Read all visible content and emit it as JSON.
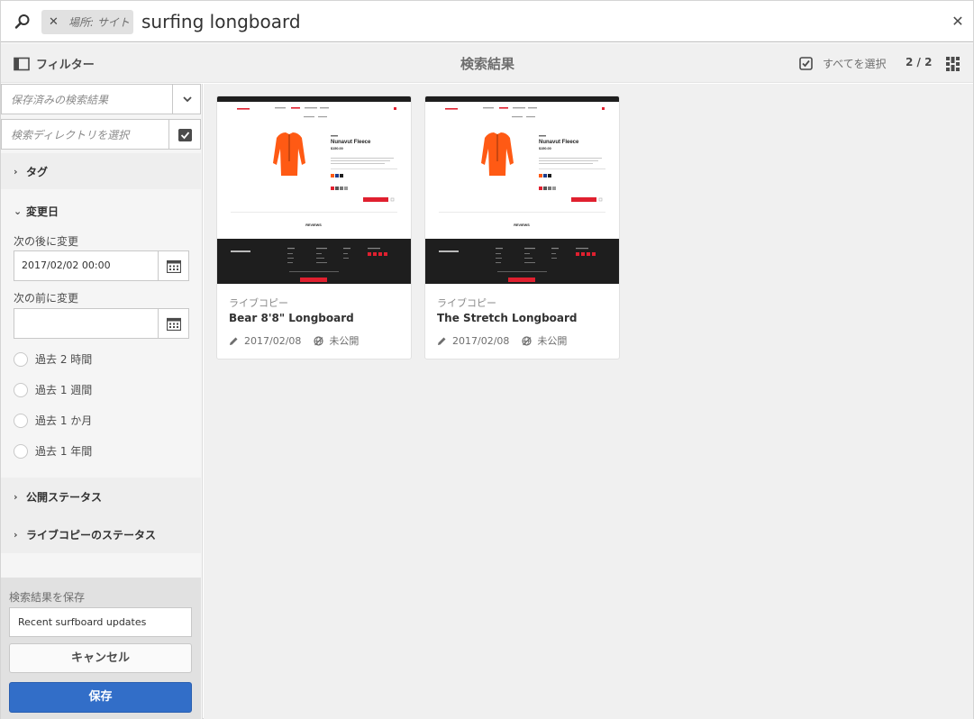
{
  "search": {
    "scope_tag": "場所: サイト",
    "query": "surfing longboard"
  },
  "actionbar": {
    "filter_label": "フィルター",
    "title": "検索結果",
    "select_all_label": "すべてを選択",
    "count": "2 / 2"
  },
  "rail": {
    "saved_search_placeholder": "保存済みの検索結果",
    "directory_placeholder": "検索ディレクトリを選択",
    "tag_section": "タグ",
    "modified_section": "変更日",
    "modified_after_label": "次の後に変更",
    "modified_after_value": "2017/02/02 00:00",
    "modified_before_label": "次の前に変更",
    "modified_before_value": "",
    "radios": [
      "過去 2 時間",
      "過去 1 週間",
      "過去 1 か月",
      "過去 1 年間"
    ],
    "publish_section": "公開ステータス",
    "livecopy_section": "ライブコピーのステータス",
    "save_label": "検索結果を保存",
    "save_value": "Recent surfboard updates",
    "cancel_label": "キャンセル",
    "save_button": "保存"
  },
  "results": [
    {
      "type": "ライブコピー",
      "title": "Bear 8'8\" Longboard",
      "date": "2017/02/08",
      "status": "未公開",
      "thumb_heading": "Nunavut Fleece",
      "thumb_price": "$150.00",
      "thumb_reviews": "REVIEWS"
    },
    {
      "type": "ライブコピー",
      "title": "The Stretch Longboard",
      "date": "2017/02/08",
      "status": "未公開",
      "thumb_heading": "Nunavut Fleece",
      "thumb_price": "$150.00",
      "thumb_reviews": "REVIEWS"
    }
  ],
  "colors": {
    "accent": "#326ec8",
    "thumb_footer": "#1e1e1e",
    "jacket": "#ff5a14",
    "thumb_red": "#e0202f"
  }
}
